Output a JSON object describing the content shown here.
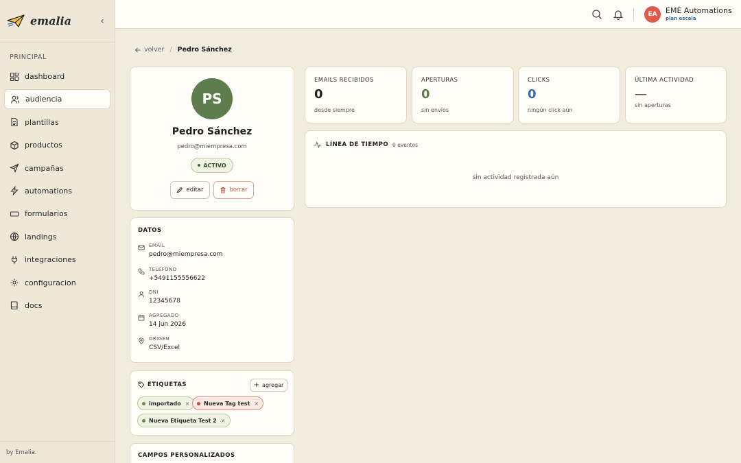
{
  "brand": {
    "name": "emalia"
  },
  "sidebar": {
    "section_label": "PRINCIPAL",
    "items": [
      {
        "label": "dashboard",
        "icon": "grid-icon"
      },
      {
        "label": "audiencia",
        "icon": "users-icon",
        "active": true
      },
      {
        "label": "plantillas",
        "icon": "file-icon"
      },
      {
        "label": "productos",
        "icon": "box-icon"
      },
      {
        "label": "campañas",
        "icon": "send-icon"
      },
      {
        "label": "automations",
        "icon": "bolt-icon"
      },
      {
        "label": "formularios",
        "icon": "form-icon"
      },
      {
        "label": "landings",
        "icon": "globe-icon"
      },
      {
        "label": "integraciones",
        "icon": "plug-icon"
      },
      {
        "label": "configuracion",
        "icon": "gear-icon"
      },
      {
        "label": "docs",
        "icon": "book-icon"
      }
    ],
    "footer": "by Emalia."
  },
  "topbar": {
    "account": {
      "initials": "EA",
      "name": "EME Automations",
      "plan": "plan escala"
    }
  },
  "breadcrumb": {
    "back": "volver",
    "current": "Pedro Sánchez"
  },
  "profile": {
    "initials": "PS",
    "name": "Pedro Sánchez",
    "email": "pedro@miempresa.com",
    "status": "ACTIVO",
    "edit_label": "editar",
    "delete_label": "borrar"
  },
  "datos": {
    "title": "DATOS",
    "fields": [
      {
        "label": "EMAIL",
        "value": "pedro@miempresa.com",
        "icon": "mail-icon"
      },
      {
        "label": "TELÉFONO",
        "value": "+5491155556622",
        "icon": "phone-icon"
      },
      {
        "label": "DNI",
        "value": "12345678",
        "icon": "user-icon"
      },
      {
        "label": "AGREGADO",
        "value": "14 jun 2026",
        "icon": "calendar-icon"
      },
      {
        "label": "ORIGEN",
        "value": "CSV/Excel",
        "icon": "pin-icon"
      }
    ]
  },
  "etiquetas": {
    "title": "ETIQUETAS",
    "add_label": "agregar",
    "tags": [
      {
        "label": "importado",
        "color": "#6b8a4e"
      },
      {
        "label": "Nueva Tag test",
        "color": "#c9452e"
      },
      {
        "label": "Nueva Etiqueta Test 2",
        "color": "#6b8a4e"
      }
    ]
  },
  "campos": {
    "title": "CAMPOS PERSONALIZADOS"
  },
  "stats": [
    {
      "label": "EMAILS RECIBIDOS",
      "value": "0",
      "sub": "desde siempre",
      "color": "#1f1f1f"
    },
    {
      "label": "APERTURAS",
      "value": "0",
      "sub": "sin envíos",
      "color": "#5e7d4c"
    },
    {
      "label": "CLICKS",
      "value": "0",
      "sub": "ningún click aún",
      "color": "#3a6fa0"
    },
    {
      "label": "ÚLTIMA ACTIVIDAD",
      "value": "—",
      "sub": "sin aperturas",
      "color": "#1f1f1f"
    }
  ],
  "timeline": {
    "title": "LÍNEA DE TIEMPO",
    "count": "0 eventos",
    "empty": "sin actividad registrada aún"
  }
}
